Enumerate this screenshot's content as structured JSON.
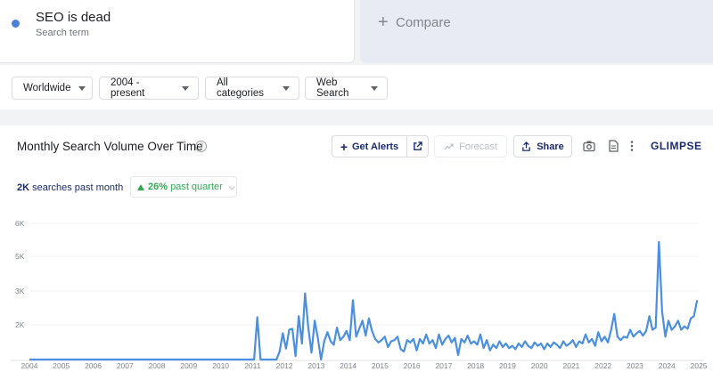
{
  "search_term": {
    "title": "SEO is dead",
    "subtitle": "Search term",
    "dot_color": "#4a7fd8"
  },
  "compare": {
    "label": "Compare"
  },
  "filters": [
    {
      "label": "Worldwide"
    },
    {
      "label": "2004 - present"
    },
    {
      "label": "All categories"
    },
    {
      "label": "Web Search"
    }
  ],
  "panel": {
    "title": "Monthly Search Volume Over Time",
    "get_alerts": "Get Alerts",
    "forecast": "Forecast",
    "share": "Share",
    "brand": "GLIMPSE",
    "volume_value": "2K",
    "volume_text": " searches past month",
    "growth": "26%",
    "growth_text": " past quarter"
  },
  "chart_data": {
    "type": "line",
    "series_color": "#4a8fe0",
    "y_ticks": [
      "6K",
      "5K",
      "3K",
      "2K"
    ],
    "x_ticks": [
      "2004",
      "2005",
      "2006",
      "2007",
      "2008",
      "2009",
      "2010",
      "2011",
      "2012",
      "2013",
      "2014",
      "2015",
      "2016",
      "2017",
      "2018",
      "2019",
      "2020",
      "2021",
      "2022",
      "2023",
      "2024",
      "2025"
    ],
    "ylim": [
      0,
      6000
    ],
    "points": [
      [
        2004.0,
        0
      ],
      [
        2010.9,
        0
      ],
      [
        2011.05,
        0
      ],
      [
        2011.15,
        1850
      ],
      [
        2011.25,
        0
      ],
      [
        2011.75,
        0
      ],
      [
        2011.85,
        350
      ],
      [
        2011.95,
        1150
      ],
      [
        2012.05,
        480
      ],
      [
        2012.15,
        1300
      ],
      [
        2012.25,
        1350
      ],
      [
        2012.35,
        150
      ],
      [
        2012.45,
        1900
      ],
      [
        2012.55,
        700
      ],
      [
        2012.65,
        2900
      ],
      [
        2012.75,
        1400
      ],
      [
        2012.85,
        300
      ],
      [
        2012.95,
        1700
      ],
      [
        2013.05,
        950
      ],
      [
        2013.15,
        0
      ],
      [
        2013.25,
        800
      ],
      [
        2013.35,
        1200
      ],
      [
        2013.45,
        800
      ],
      [
        2013.55,
        650
      ],
      [
        2013.65,
        1400
      ],
      [
        2013.75,
        850
      ],
      [
        2013.85,
        1000
      ],
      [
        2013.95,
        1250
      ],
      [
        2014.05,
        850
      ],
      [
        2014.15,
        2600
      ],
      [
        2014.25,
        1000
      ],
      [
        2014.35,
        1350
      ],
      [
        2014.45,
        1700
      ],
      [
        2014.55,
        1050
      ],
      [
        2014.65,
        1800
      ],
      [
        2014.75,
        1250
      ],
      [
        2014.85,
        900
      ],
      [
        2014.95,
        750
      ],
      [
        2015.05,
        850
      ],
      [
        2015.15,
        1000
      ],
      [
        2015.25,
        550
      ],
      [
        2015.35,
        800
      ],
      [
        2015.45,
        850
      ],
      [
        2015.55,
        1000
      ],
      [
        2015.65,
        450
      ],
      [
        2015.75,
        350
      ],
      [
        2015.85,
        850
      ],
      [
        2015.95,
        750
      ],
      [
        2016.05,
        900
      ],
      [
        2016.15,
        400
      ],
      [
        2016.25,
        900
      ],
      [
        2016.35,
        700
      ],
      [
        2016.45,
        1100
      ],
      [
        2016.55,
        700
      ],
      [
        2016.65,
        850
      ],
      [
        2016.75,
        500
      ],
      [
        2016.85,
        1100
      ],
      [
        2016.95,
        650
      ],
      [
        2017.05,
        900
      ],
      [
        2017.15,
        1050
      ],
      [
        2017.25,
        750
      ],
      [
        2017.35,
        950
      ],
      [
        2017.45,
        200
      ],
      [
        2017.55,
        900
      ],
      [
        2017.65,
        750
      ],
      [
        2017.75,
        1050
      ],
      [
        2017.85,
        700
      ],
      [
        2017.95,
        800
      ],
      [
        2018.05,
        650
      ],
      [
        2018.15,
        1100
      ],
      [
        2018.25,
        500
      ],
      [
        2018.35,
        850
      ],
      [
        2018.45,
        400
      ],
      [
        2018.55,
        650
      ],
      [
        2018.65,
        500
      ],
      [
        2018.75,
        800
      ],
      [
        2018.85,
        550
      ],
      [
        2018.95,
        700
      ],
      [
        2019.05,
        500
      ],
      [
        2019.15,
        600
      ],
      [
        2019.25,
        450
      ],
      [
        2019.35,
        700
      ],
      [
        2019.45,
        550
      ],
      [
        2019.55,
        800
      ],
      [
        2019.65,
        600
      ],
      [
        2019.75,
        500
      ],
      [
        2019.85,
        750
      ],
      [
        2019.95,
        600
      ],
      [
        2020.05,
        700
      ],
      [
        2020.15,
        450
      ],
      [
        2020.25,
        700
      ],
      [
        2020.35,
        550
      ],
      [
        2020.45,
        750
      ],
      [
        2020.55,
        650
      ],
      [
        2020.65,
        500
      ],
      [
        2020.75,
        800
      ],
      [
        2020.85,
        600
      ],
      [
        2020.95,
        700
      ],
      [
        2021.05,
        850
      ],
      [
        2021.15,
        550
      ],
      [
        2021.25,
        800
      ],
      [
        2021.35,
        700
      ],
      [
        2021.45,
        1100
      ],
      [
        2021.55,
        750
      ],
      [
        2021.65,
        900
      ],
      [
        2021.75,
        600
      ],
      [
        2021.85,
        1200
      ],
      [
        2021.95,
        800
      ],
      [
        2022.05,
        1000
      ],
      [
        2022.15,
        750
      ],
      [
        2022.25,
        1300
      ],
      [
        2022.35,
        2000
      ],
      [
        2022.45,
        1000
      ],
      [
        2022.55,
        850
      ],
      [
        2022.65,
        1000
      ],
      [
        2022.75,
        950
      ],
      [
        2022.85,
        1300
      ],
      [
        2022.95,
        1000
      ],
      [
        2023.05,
        1150
      ],
      [
        2023.15,
        1250
      ],
      [
        2023.25,
        1050
      ],
      [
        2023.35,
        1250
      ],
      [
        2023.45,
        1900
      ],
      [
        2023.55,
        1300
      ],
      [
        2023.65,
        1400
      ],
      [
        2023.75,
        5150
      ],
      [
        2023.85,
        2100
      ],
      [
        2023.95,
        1000
      ],
      [
        2024.05,
        1700
      ],
      [
        2024.15,
        1300
      ],
      [
        2024.25,
        1450
      ],
      [
        2024.35,
        1700
      ],
      [
        2024.45,
        1300
      ],
      [
        2024.55,
        1450
      ],
      [
        2024.65,
        1350
      ],
      [
        2024.75,
        1800
      ],
      [
        2024.85,
        1900
      ],
      [
        2024.95,
        2600
      ]
    ]
  }
}
